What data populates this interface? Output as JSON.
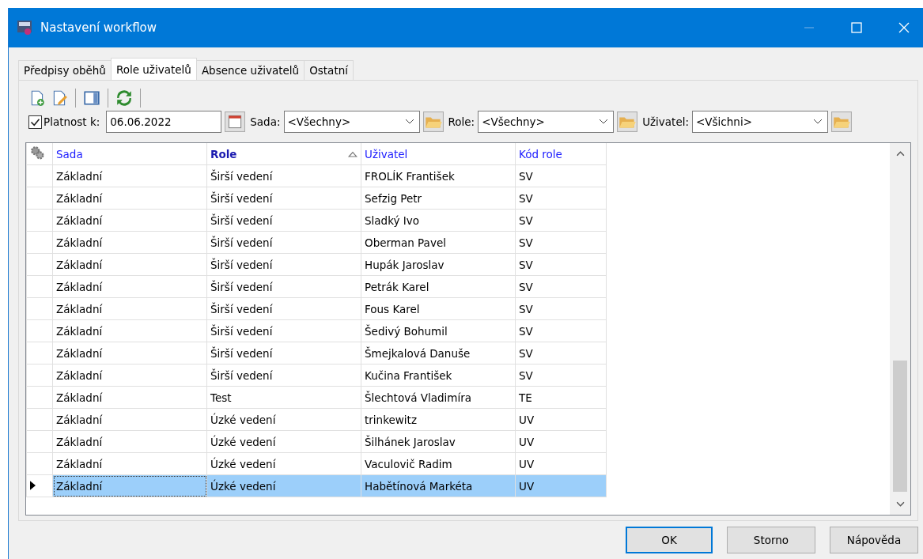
{
  "window": {
    "title": "Nastavení workflow"
  },
  "tabs": [
    {
      "label": "Předpisy oběhů",
      "selected": false
    },
    {
      "label": "Role uživatelů",
      "selected": true
    },
    {
      "label": "Absence uživatelů",
      "selected": false
    },
    {
      "label": "Ostatní",
      "selected": false
    }
  ],
  "filters": {
    "validity": {
      "label": "Platnost k:",
      "checked": true,
      "value": "06.06.2022"
    },
    "combos": [
      {
        "label": "Sada:",
        "value": "<Všechny>"
      },
      {
        "label": "Role:",
        "value": "<Všechny>"
      },
      {
        "label": "Uživatel:",
        "value": "<Všichni>"
      }
    ]
  },
  "table": {
    "columns": [
      {
        "label": "Sada",
        "sorted": false
      },
      {
        "label": "Role",
        "sorted": true
      },
      {
        "label": "Uživatel",
        "sorted": false
      },
      {
        "label": "Kód role",
        "sorted": false
      }
    ],
    "rows": [
      {
        "cells": [
          "Základní",
          "Širší vedení",
          "FROLÍK František",
          "SV"
        ],
        "selected": false
      },
      {
        "cells": [
          "Základní",
          "Širší vedení",
          "Sefzig Petr",
          "SV"
        ],
        "selected": false
      },
      {
        "cells": [
          "Základní",
          "Širší vedení",
          "Sladký Ivo",
          "SV"
        ],
        "selected": false
      },
      {
        "cells": [
          "Základní",
          "Širší vedení",
          "Oberman Pavel",
          "SV"
        ],
        "selected": false
      },
      {
        "cells": [
          "Základní",
          "Širší vedení",
          "Hupák Jaroslav",
          "SV"
        ],
        "selected": false
      },
      {
        "cells": [
          "Základní",
          "Širší vedení",
          "Petrák Karel",
          "SV"
        ],
        "selected": false
      },
      {
        "cells": [
          "Základní",
          "Širší vedení",
          "Fous Karel",
          "SV"
        ],
        "selected": false
      },
      {
        "cells": [
          "Základní",
          "Širší vedení",
          "Šedivý Bohumil",
          "SV"
        ],
        "selected": false
      },
      {
        "cells": [
          "Základní",
          "Širší vedení",
          "Šmejkalová Danuše",
          "SV"
        ],
        "selected": false
      },
      {
        "cells": [
          "Základní",
          "Širší vedení",
          "Kučina František",
          "SV"
        ],
        "selected": false
      },
      {
        "cells": [
          "Základní",
          "Test",
          "Šlechtová Vladimíra",
          "TE"
        ],
        "selected": false
      },
      {
        "cells": [
          "Základní",
          "Úzké vedení",
          "trinkewitz",
          "UV"
        ],
        "selected": false
      },
      {
        "cells": [
          "Základní",
          "Úzké vedení",
          "Šilhánek Jaroslav",
          "UV"
        ],
        "selected": false
      },
      {
        "cells": [
          "Základní",
          "Úzké vedení",
          "Vaculovič Radim",
          "UV"
        ],
        "selected": false
      },
      {
        "cells": [
          "Základní",
          "Úzké vedení",
          "Habětínová Markéta",
          "UV"
        ],
        "selected": true
      }
    ]
  },
  "buttons": [
    {
      "label": "OK",
      "default": true
    },
    {
      "label": "Storno",
      "default": false
    },
    {
      "label": "Nápověda",
      "default": false
    }
  ]
}
